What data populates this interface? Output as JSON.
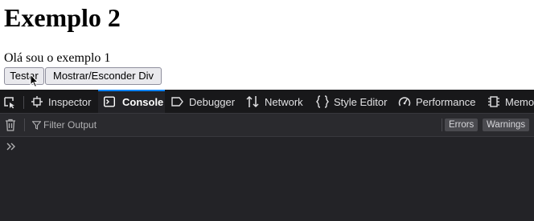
{
  "page": {
    "heading": "Exemplo 2",
    "paragraph": "Olá sou o exemplo 1",
    "buttons": {
      "test": "Testar",
      "toggle": "Mostrar/Esconder Div"
    }
  },
  "devtools": {
    "tabs": [
      {
        "label": "Inspector",
        "icon": "inspector-icon"
      },
      {
        "label": "Console",
        "icon": "console-icon",
        "active": true
      },
      {
        "label": "Debugger",
        "icon": "debugger-icon"
      },
      {
        "label": "Network",
        "icon": "network-icon"
      },
      {
        "label": "Style Editor",
        "icon": "style-editor-icon"
      },
      {
        "label": "Performance",
        "icon": "performance-icon"
      },
      {
        "label": "Memo",
        "icon": "memory-icon"
      }
    ],
    "toolbar": {
      "filter_placeholder": "Filter Output",
      "chips": {
        "errors": "Errors",
        "warnings": "Warnings"
      }
    },
    "colors": {
      "active_tab_accent": "#0a84ff",
      "panel_bg": "#232327",
      "tabbar_bg": "#18181a"
    }
  }
}
